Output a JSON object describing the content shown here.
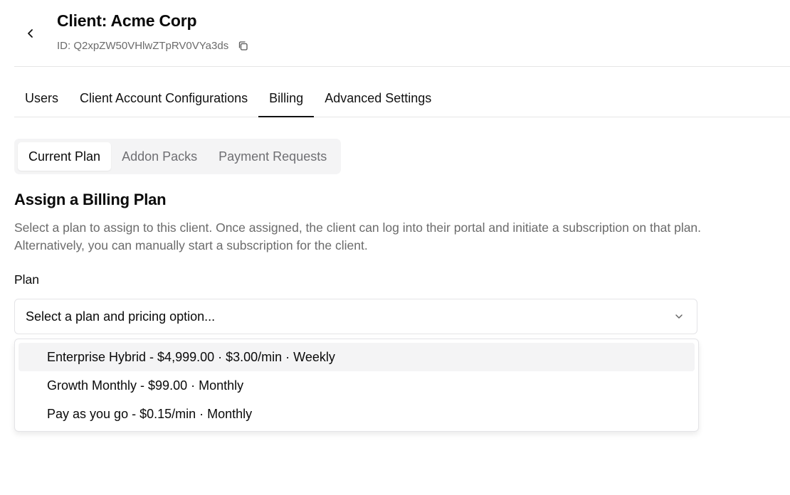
{
  "header": {
    "title": "Client: Acme Corp",
    "client_id": "ID: Q2xpZW50VHlwZTpRV0VYa3ds"
  },
  "main_tabs": [
    {
      "label": "Users",
      "active": false
    },
    {
      "label": "Client Account Configurations",
      "active": false
    },
    {
      "label": "Billing",
      "active": true
    },
    {
      "label": "Advanced Settings",
      "active": false
    }
  ],
  "sub_tabs": [
    {
      "label": "Current Plan",
      "active": true
    },
    {
      "label": "Addon Packs",
      "active": false
    },
    {
      "label": "Payment Requests",
      "active": false
    }
  ],
  "section": {
    "title": "Assign a Billing Plan",
    "description": "Select a plan to assign to this client. Once assigned, the client can log into their portal and initiate a subscription on that plan. Alternatively, you can manually start a subscription for the client."
  },
  "plan_field": {
    "label": "Plan",
    "placeholder": "Select a plan and pricing option...",
    "options": [
      {
        "label": "Enterprise Hybrid - $4,999.00 · $3.00/min · Weekly",
        "highlighted": true
      },
      {
        "label": "Growth Monthly - $99.00 · Monthly",
        "highlighted": false
      },
      {
        "label": "Pay as you go - $0.15/min · Monthly",
        "highlighted": false
      }
    ]
  },
  "icons": {
    "back": "chevron-left-icon",
    "copy": "copy-icon",
    "select": "chevron-down-icon"
  },
  "colors": {
    "text_primary": "#0a0a0a",
    "text_muted": "#6b6b6b",
    "border": "#e4e4e7",
    "muted_bg": "#f4f4f5"
  }
}
